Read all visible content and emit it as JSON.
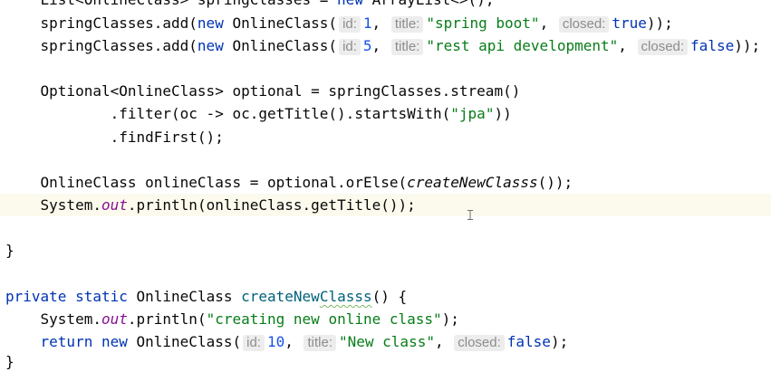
{
  "editor": {
    "theme": {
      "background": "#ffffff",
      "text": "#080808",
      "current_line": "#fcfaed",
      "keyword": "#0033b3",
      "string": "#067d17",
      "number": "#1750eb",
      "static_field": "#871094",
      "method_declaration": "#00627a",
      "hint_text": "#8c8c8c",
      "hint_background": "#ededed",
      "typo_underline": "#7ab861",
      "mouse_pointer": "#6e6e6e"
    },
    "lines": [
      {
        "tokens": [
          {
            "plain": "    List<OnlineClass> springClasses = "
          },
          {
            "keyword": "new"
          },
          {
            "plain": " ArrayList<>();"
          }
        ]
      },
      {
        "tokens": [
          {
            "plain": "    springClasses.add("
          },
          {
            "keyword": "new"
          },
          {
            "plain": " OnlineClass("
          },
          {
            "hint": "id:"
          },
          {
            "number": "1"
          },
          {
            "plain": ", "
          },
          {
            "hint": "title:"
          },
          {
            "string": "\"spring boot\""
          },
          {
            "plain": ", "
          },
          {
            "hint": "closed:"
          },
          {
            "keyword": "true"
          },
          {
            "plain": "));"
          }
        ]
      },
      {
        "tokens": [
          {
            "plain": "    springClasses.add("
          },
          {
            "keyword": "new"
          },
          {
            "plain": " OnlineClass("
          },
          {
            "hint": "id:"
          },
          {
            "number": "5"
          },
          {
            "plain": ", "
          },
          {
            "hint": "title:"
          },
          {
            "string": "\"rest api development\""
          },
          {
            "plain": ", "
          },
          {
            "hint": "closed:"
          },
          {
            "keyword": "false"
          },
          {
            "plain": "));"
          }
        ]
      },
      {
        "tokens": []
      },
      {
        "tokens": [
          {
            "plain": "    Optional<OnlineClass> optional = springClasses.stream()"
          }
        ]
      },
      {
        "tokens": [
          {
            "plain": "            .filter(oc -> oc.getTitle().startsWith("
          },
          {
            "string": "\"jpa\""
          },
          {
            "plain": "))"
          }
        ]
      },
      {
        "tokens": [
          {
            "plain": "            .findFirst();"
          }
        ]
      },
      {
        "tokens": []
      },
      {
        "tokens": [
          {
            "plain": "    OnlineClass onlineClass = optional.orElse("
          },
          {
            "static_call": "createNewClasss"
          },
          {
            "plain": "());"
          }
        ]
      },
      {
        "current": true,
        "tokens": [
          {
            "plain": "    System."
          },
          {
            "static_field": "out"
          },
          {
            "plain": ".println(onlineClass.getTitle());"
          }
        ]
      },
      {
        "tokens": []
      },
      {
        "tokens": [
          {
            "plain": "}"
          }
        ]
      },
      {
        "tokens": []
      },
      {
        "tokens": [
          {
            "keyword": "private"
          },
          {
            "plain": " "
          },
          {
            "keyword": "static"
          },
          {
            "plain": " OnlineClass "
          },
          {
            "method_decl": "createNew"
          },
          {
            "method_decl_typo": "Classs"
          },
          {
            "plain": "() {"
          }
        ]
      },
      {
        "tokens": [
          {
            "plain": "    System."
          },
          {
            "static_field": "out"
          },
          {
            "plain": ".println("
          },
          {
            "string": "\"creating new online class\""
          },
          {
            "plain": ");"
          }
        ]
      },
      {
        "tokens": [
          {
            "plain": "    "
          },
          {
            "keyword": "return"
          },
          {
            "plain": " "
          },
          {
            "keyword": "new"
          },
          {
            "plain": " OnlineClass("
          },
          {
            "hint": "id:"
          },
          {
            "number": "10"
          },
          {
            "plain": ", "
          },
          {
            "hint": "title:"
          },
          {
            "string": "\"New class\""
          },
          {
            "plain": ", "
          },
          {
            "hint": "closed:"
          },
          {
            "keyword": "false"
          },
          {
            "plain": ");"
          }
        ]
      },
      {
        "tokens": [
          {
            "plain": "}"
          }
        ]
      }
    ]
  },
  "mouse_pointer": {
    "icon": "text-cursor-icon"
  }
}
